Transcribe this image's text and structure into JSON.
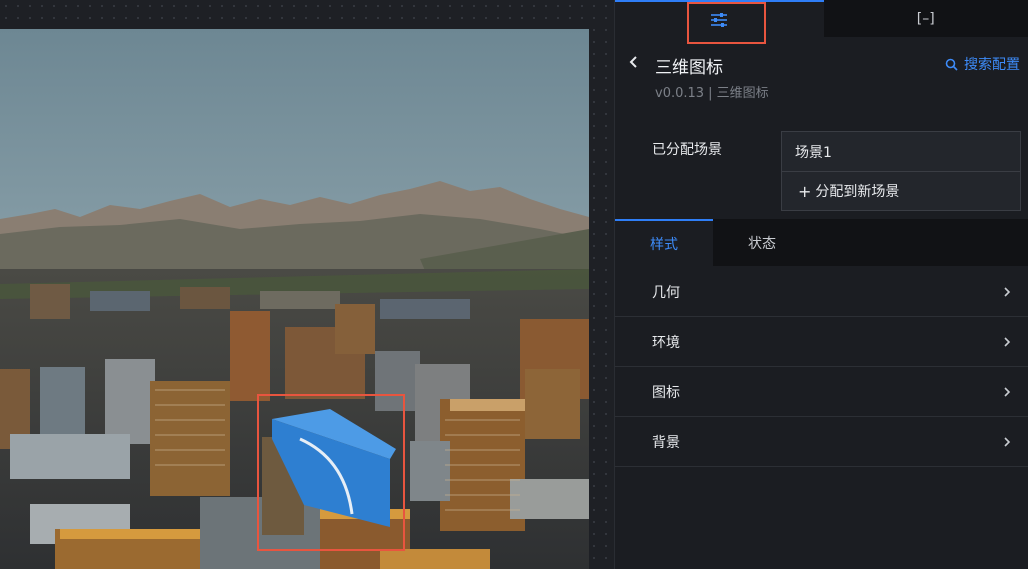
{
  "panel": {
    "tabs": [
      {
        "icon": "sliders-icon"
      },
      {
        "icon": "collapse-icon",
        "label": "[–]"
      }
    ],
    "title": "三维图标",
    "subtitle": "v0.0.13 | 三维图标",
    "search_config": "搜索配置",
    "scene": {
      "label": "已分配场景",
      "current": "场景1",
      "add_label": "分配到新场景"
    },
    "subtabs": [
      "样式",
      "状态"
    ],
    "sections": [
      "几何",
      "环境",
      "图标",
      "背景"
    ]
  },
  "colors": {
    "accent": "#2f7ef7",
    "highlight": "#e8553f",
    "panel_bg": "#1b1d22"
  }
}
